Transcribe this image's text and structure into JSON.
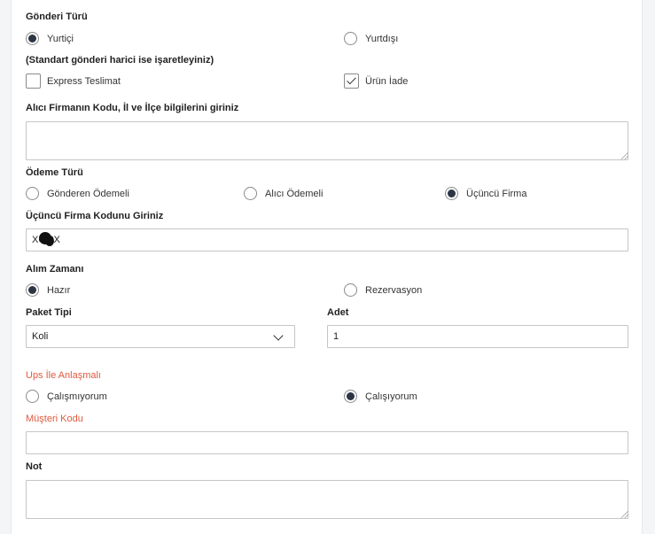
{
  "shipment_type": {
    "label": "Gönderi Türü",
    "options": [
      "Yurtiçi",
      "Yurtdışı"
    ],
    "selected": "Yurtiçi"
  },
  "extras": {
    "label": "(Standart gönderi harici ise işaretleyiniz)",
    "express": {
      "label": "Express Teslimat",
      "checked": false
    },
    "return": {
      "label": "Ürün İade",
      "checked": true
    }
  },
  "recipient": {
    "label": "Alıcı Firmanın Kodu, İl ve İlçe bilgilerini giriniz",
    "value": ""
  },
  "payment_type": {
    "label": "Ödeme Türü",
    "options": [
      "Gönderen Ödemeli",
      "Alıcı Ödemeli",
      "Üçüncü Firma"
    ],
    "selected": "Üçüncü Firma"
  },
  "third_party": {
    "label": "Üçüncü Firma Kodunu Giriniz",
    "value": "XC    3X"
  },
  "pickup_time": {
    "label": "Alım Zamanı",
    "options": [
      "Hazır",
      "Rezervasyon"
    ],
    "selected": "Hazır"
  },
  "package": {
    "label": "Paket Tipi",
    "value": "Koli"
  },
  "quantity": {
    "label": "Adet",
    "value": "1"
  },
  "ups_agreement": {
    "label": "Ups İle Anlaşmalı",
    "options": [
      "Çalışmıyorum",
      "Çalışıyorum"
    ],
    "selected": "Çalışıyorum"
  },
  "customer_code": {
    "label": "Müşteri Kodu",
    "value": ""
  },
  "note": {
    "label": "Not",
    "value": ""
  },
  "colors": {
    "accent": "#2d3545",
    "warning": "#e05a3e",
    "border": "#c6c6c6"
  }
}
